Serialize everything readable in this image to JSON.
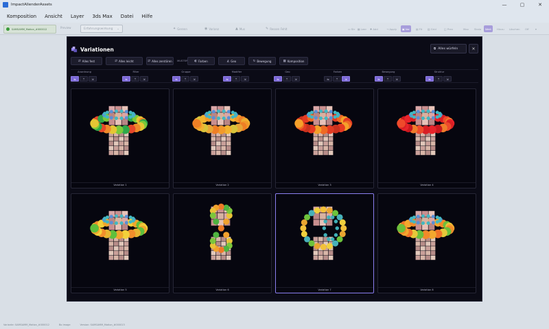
{
  "window": {
    "title": "ImpactAllenderAssets",
    "controls": [
      "—",
      "▢",
      "✕"
    ]
  },
  "menu": [
    "Komposition",
    "Ansicht",
    "Layer",
    "3ds Max",
    "Datei",
    "Hilfe"
  ],
  "toolbar": {
    "file_chip": "SAMSAMM_Motion_#000012",
    "plain_label": "Preview",
    "select_value": "Erfahrungswirkung",
    "center_buttons": [
      {
        "icon": "✦",
        "label": "Gerenn"
      },
      {
        "icon": "◉",
        "label": "Varianz"
      },
      {
        "icon": "▲",
        "label": "Mus"
      },
      {
        "icon": "✎",
        "label": "Ressen Fehlt"
      }
    ],
    "right_buttons": [
      {
        "label": "▭ Str",
        "active": false
      },
      {
        "label": "▦ Leer",
        "active": false
      },
      {
        "label": "✚ Add",
        "active": false
      },
      {
        "label": "⇢ Apply",
        "active": false
      },
      {
        "label": "▣ Var",
        "active": true
      },
      {
        "label": "▤ Fit",
        "active": false
      },
      {
        "label": "▥ Grid",
        "active": false
      },
      {
        "label": "◫ Prev",
        "active": false
      },
      {
        "label": "Max",
        "active": false
      },
      {
        "label": "Skala",
        "active": false
      },
      {
        "label": "Wert",
        "active": true
      },
      {
        "label": "Hinzu",
        "active": false
      },
      {
        "label": "Löschen",
        "active": false
      },
      {
        "label": "Off",
        "active": false
      },
      {
        "label": "▾",
        "active": false
      }
    ]
  },
  "dialog": {
    "title": "Variationen",
    "export_label": "Alles würfeln",
    "close_icon": "✕",
    "actions": [
      {
        "icon": "⇄",
        "label": "Alles fest"
      },
      {
        "icon": "⇄",
        "label": "Alles leicht"
      },
      {
        "icon": "⇄",
        "label": "Alles zerstören"
      },
      {
        "icon": "◐",
        "label": "Farben"
      },
      {
        "icon": "◭",
        "label": "Geo"
      },
      {
        "icon": "↻",
        "label": "Bewegung"
      },
      {
        "icon": "▦",
        "label": "Komposition"
      }
    ],
    "actions_separator": "MUSTER",
    "filters": [
      {
        "label": "Anordnung",
        "active": 0
      },
      {
        "label": "Filter",
        "active": 0
      },
      {
        "label": "Gruppe",
        "active": 0
      },
      {
        "label": "Modifier",
        "active": 0
      },
      {
        "label": "Geo",
        "active": 0
      },
      {
        "label": "Farben",
        "active": 2
      },
      {
        "label": "Bewegung",
        "active": 0
      },
      {
        "label": "Struktur",
        "active": 0
      }
    ],
    "filter_icons": [
      "⇋",
      "⇡",
      "⇲"
    ],
    "variations": [
      {
        "label": "Variation 1",
        "ring": "warm-mix",
        "selected": false
      },
      {
        "label": "Variation 2",
        "ring": "orange",
        "selected": false
      },
      {
        "label": "Variation 3",
        "ring": "red-orange",
        "selected": false
      },
      {
        "label": "Variation 4",
        "ring": "red",
        "selected": false
      },
      {
        "label": "Variation 5",
        "ring": "yellow-orange",
        "selected": false
      },
      {
        "label": "Variation 6",
        "ring": "twisted",
        "selected": false
      },
      {
        "label": "Variation 7",
        "ring": "vertical",
        "selected": true
      },
      {
        "label": "Variation 8",
        "ring": "orange-green",
        "selected": false
      }
    ]
  },
  "status": {
    "variant": "Variante: SAMSAMM_Motion_#000012",
    "zoom": "Bo image",
    "version": "Version: SAMSAMM_Motion_#000013"
  },
  "colors": {
    "accent": "#7b68d6",
    "dialog_bg": "#0b0b16",
    "app_bg": "#dde3ea"
  }
}
